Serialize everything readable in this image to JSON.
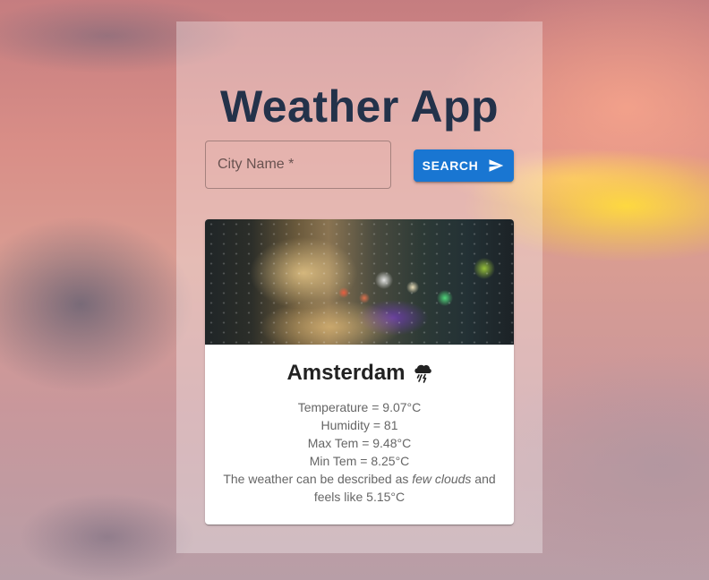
{
  "app": {
    "title": "Weather App"
  },
  "search": {
    "placeholder": "City Name *",
    "value": "",
    "button_label": "SEARCH",
    "button_icon": "send-icon"
  },
  "card": {
    "city": "Amsterdam",
    "condition_icon": "thunderstorm-icon",
    "temperature": "Temperature = 9.07°C",
    "humidity": "Humidity = 81",
    "max_temp": "Max Tem = 9.48°C",
    "min_temp": "Min Tem = 8.25°C",
    "description_prefix": "The weather can be described as",
    "description_condition": "few clouds",
    "description_mid": "and",
    "feels_like": "feels like 5.15°C"
  },
  "colors": {
    "title": "#23324a",
    "accent": "#1976d2",
    "card_text": "#666666"
  }
}
